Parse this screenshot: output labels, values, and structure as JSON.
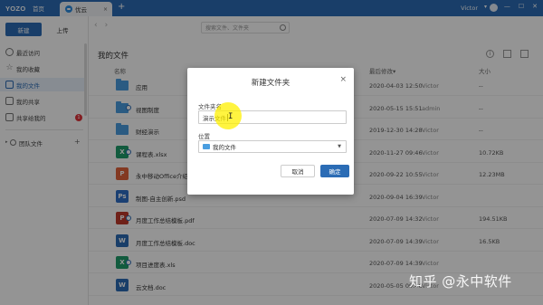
{
  "titlebar": {
    "logo": "YOZO",
    "home_tab": "首页",
    "doc_tab": "优云",
    "tab_close": "×",
    "add_tab": "+",
    "user": "Victor",
    "user_caret": "▾",
    "win_min": "—",
    "win_max": "☐",
    "win_close": "✕"
  },
  "sidebar": {
    "new_label": "新建",
    "upload_label": "上传",
    "items": [
      {
        "label": "最近访问"
      },
      {
        "label": "我的收藏"
      },
      {
        "label": "我的文件"
      },
      {
        "label": "我的共享"
      },
      {
        "label": "共享给我的",
        "badge": "1"
      }
    ],
    "team_label": "团队文件",
    "team_arrow": "▸",
    "team_plus": "+"
  },
  "main": {
    "nav_back": "‹",
    "nav_fwd": "›",
    "search_placeholder": "搜索文件、文件夹",
    "title": "我的文件",
    "columns": {
      "name": "名称",
      "date": "最后修改▾",
      "size": "大小"
    },
    "files": [
      {
        "name": "应用",
        "type": "folder",
        "date": "2020-04-03 12:50",
        "owner": "Victor",
        "size": "--"
      },
      {
        "name": "视图制度",
        "type": "folder",
        "date": "2020-05-15 15:51",
        "owner": "admin",
        "size": "--",
        "shared": true
      },
      {
        "name": "财经演示",
        "type": "folder",
        "date": "2019-12-30 14:28",
        "owner": "Victor",
        "size": "--"
      },
      {
        "name": "课程表.xlsx",
        "type": "xls",
        "icon_label": "X",
        "date": "2020-11-27 09:46",
        "owner": "Victor",
        "size": "10.72KB",
        "shared": true
      },
      {
        "name": "永中移动Office介绍",
        "type": "ppt",
        "icon_label": "P",
        "date": "2020-09-22 10:55",
        "owner": "Victor",
        "size": "12.23MB"
      },
      {
        "name": "制图-自主创新.psd",
        "type": "psd",
        "icon_label": "Ps",
        "date": "2020-09-04 16:39",
        "owner": "Victor",
        "size": ""
      },
      {
        "name": "月度工作总结模板.pdf",
        "type": "pdf",
        "icon_label": "P",
        "date": "2020-07-09 14:32",
        "owner": "Victor",
        "size": "194.51KB",
        "shared": true
      },
      {
        "name": "月度工作总结模板.doc",
        "type": "doc",
        "icon_label": "W",
        "date": "2020-07-09 14:39",
        "owner": "Victor",
        "size": "16.5KB"
      },
      {
        "name": "项目进度表.xls",
        "type": "xls",
        "icon_label": "X",
        "date": "2020-07-09 14:39",
        "owner": "Victor",
        "size": "",
        "shared": true
      },
      {
        "name": "云文档.doc",
        "type": "doc",
        "icon_label": "W",
        "date": "2020-05-05 09:46",
        "owner": "Victor",
        "size": ""
      }
    ]
  },
  "dialog": {
    "title": "新建文件夹",
    "close": "×",
    "name_label": "文件夹名",
    "name_value": "演示文件",
    "location_label": "位置",
    "location_value": "我的文件",
    "cancel_label": "取消",
    "ok_label": "确定",
    "cursor_glyph": "I"
  },
  "watermark": "知乎 @永中软件",
  "colors": {
    "accent": "#2b6cb5",
    "badge": "#e0333a",
    "highlight": "#fff000"
  }
}
